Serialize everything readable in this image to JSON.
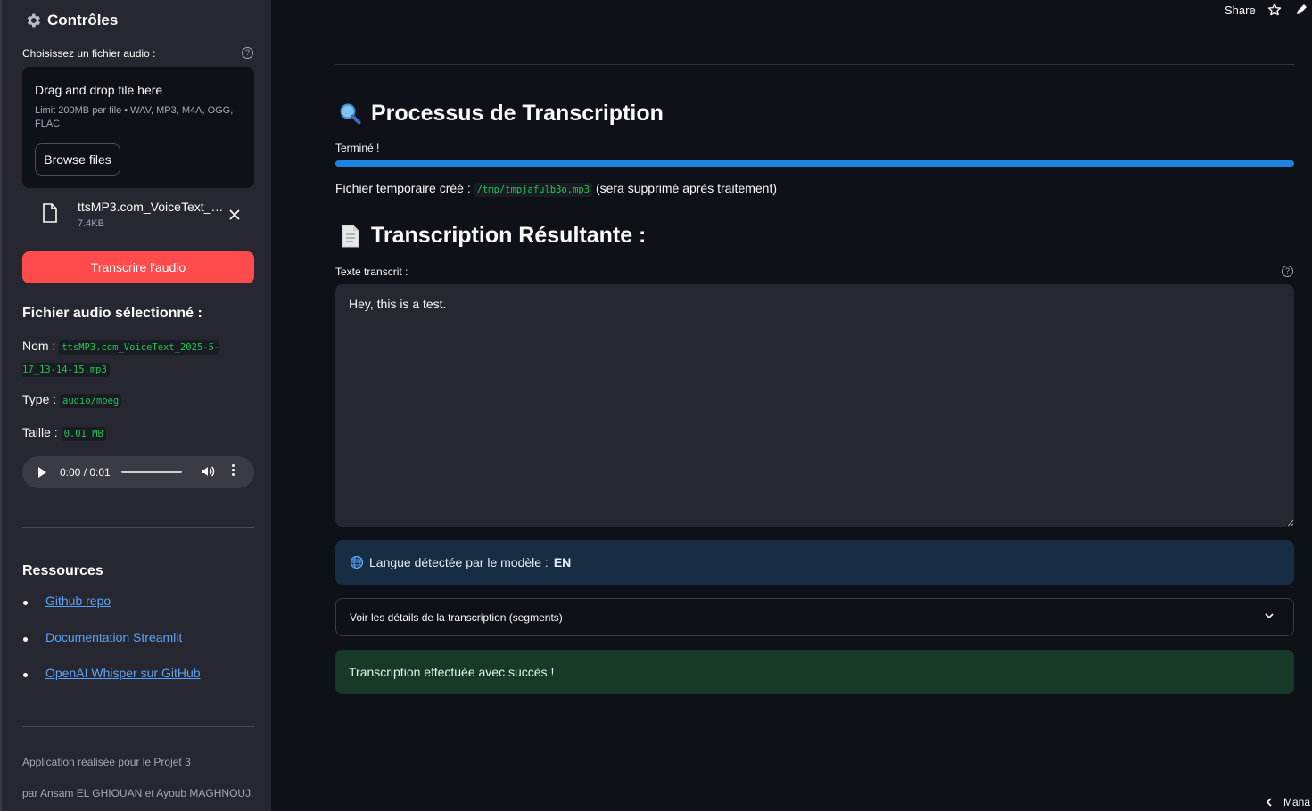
{
  "sidebar": {
    "title": "Contrôles",
    "uploader_label": "Choisissez un fichier audio :",
    "dropzone_title": "Drag and drop file here",
    "dropzone_limit": "Limit 200MB per file • WAV, MP3, M4A, OGG, FLAC",
    "browse_label": "Browse files",
    "file_name": "ttsMP3.com_VoiceText_2025-5-17_13-14-15.mp3",
    "file_size": "7.4KB",
    "transcribe_label": "Transcrire l'audio",
    "selected_heading": "Fichier audio sélectionné :",
    "name_label": "Nom :",
    "name_value": "ttsMP3.com_VoiceText_2025-5-17_13-14-15.mp3",
    "type_label": "Type :",
    "type_value": "audio/mpeg",
    "size_label": "Taille :",
    "size_value": "0.01 MB",
    "audio_time": "0:00 / 0:01",
    "resources_heading": "Ressources",
    "resources": [
      {
        "label": "Github repo"
      },
      {
        "label": "Documentation Streamlit"
      },
      {
        "label": "OpenAI Whisper sur GitHub"
      }
    ],
    "footer_line1": "Application réalisée pour le Projet 3",
    "footer_line2": "par Ansam EL GHIOUAN et Ayoub MAGHNOUJ."
  },
  "header": {
    "share_label": "Share"
  },
  "main": {
    "process_heading": "Processus de Transcription",
    "progress_label": "Terminé !",
    "progress_fraction": 1.0,
    "temp_prefix": "Fichier temporaire créé :",
    "temp_path": "/tmp/tmpjafulb3o.mp3",
    "temp_suffix": "(sera supprimé après traitement)",
    "result_heading": "Transcription Résultante :",
    "textarea_label": "Texte transcrit :",
    "transcript": "Hey, this is a test.",
    "language_prefix": "Langue détectée par le modèle :",
    "language_value": "EN",
    "expander_label": "Voir les détails de la transcription (segments)",
    "success_message": "Transcription effectuée avec succès !",
    "manage_label": "Mana"
  },
  "colors": {
    "primary_button": "#ff4b4b",
    "progress": "#1c83e1",
    "link": "#5ba4f7",
    "code": "#21c354",
    "info_bg": "#172d43",
    "success_bg": "#173928"
  }
}
